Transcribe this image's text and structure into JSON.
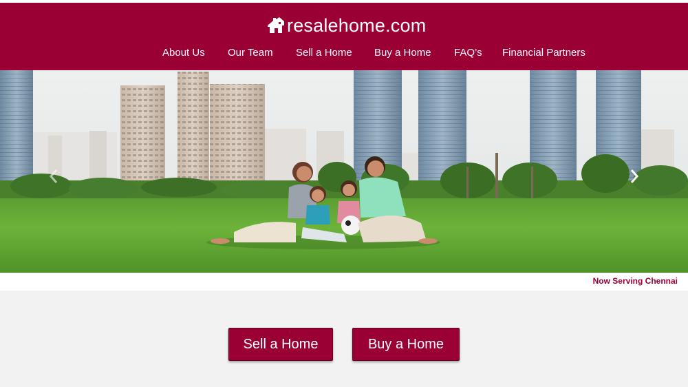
{
  "brand": {
    "logo_text": "resalehome.com",
    "color": "#9a0033"
  },
  "nav": {
    "items": [
      {
        "label": "About Us"
      },
      {
        "label": "Our Team"
      },
      {
        "label": "Sell a Home"
      },
      {
        "label": "Buy a Home"
      },
      {
        "label": "FAQ’s"
      },
      {
        "label": "Financial Partners"
      }
    ]
  },
  "hero": {
    "image_icon": "family-on-lawn-image",
    "prev_icon": "chevron-left-icon",
    "next_icon": "chevron-right-icon",
    "caption": "Now Serving Chennai"
  },
  "cta": {
    "sell_label": "Sell a Home",
    "buy_label": "Buy a Home"
  }
}
